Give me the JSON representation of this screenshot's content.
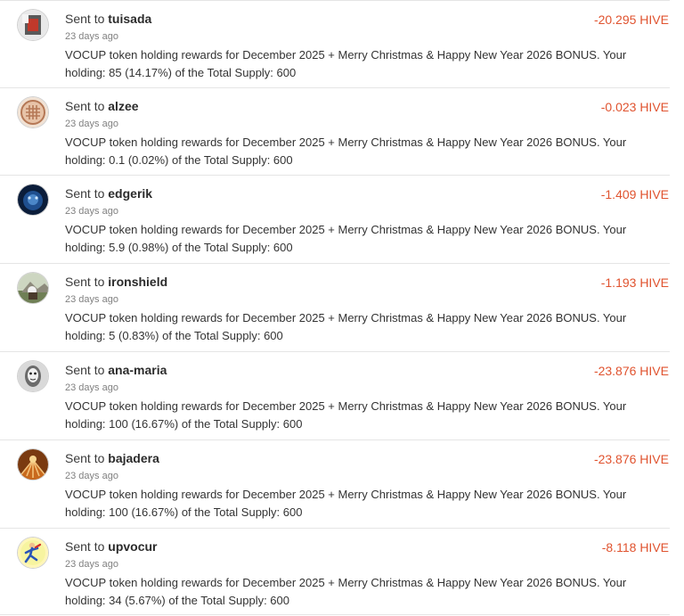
{
  "accent_amount_color": "#e0532f",
  "transfers": [
    {
      "prefix": "Sent to",
      "user": "tuisada",
      "time": "23 days ago",
      "memo": "VOCUP token holding rewards for December 2025 + Merry Christmas & Happy New Year 2026 BONUS. Your holding: 85 (14.17%) of the Total Supply: 600",
      "amount": "-20.295 HIVE",
      "avatar_icon": "phone-photo-avatar"
    },
    {
      "prefix": "Sent to",
      "user": "alzee",
      "time": "23 days ago",
      "memo": "VOCUP token holding rewards for December 2025 + Merry Christmas & Happy New Year 2026 BONUS. Your holding: 0.1 (0.02%) of the Total Supply: 600",
      "amount": "-0.023 HIVE",
      "avatar_icon": "crosshatch-logo-avatar"
    },
    {
      "prefix": "Sent to",
      "user": "edgerik",
      "time": "23 days ago",
      "memo": "VOCUP token holding rewards for December 2025 + Merry Christmas & Happy New Year 2026 BONUS. Your holding: 5.9 (0.98%) of the Total Supply: 600",
      "amount": "-1.409 HIVE",
      "avatar_icon": "blue-creature-avatar"
    },
    {
      "prefix": "Sent to",
      "user": "ironshield",
      "time": "23 days ago",
      "memo": "VOCUP token holding rewards for December 2025 + Merry Christmas & Happy New Year 2026 BONUS. Your holding: 5 (0.83%) of the Total Supply: 600",
      "amount": "-1.193 HIVE",
      "avatar_icon": "landscape-photo-avatar"
    },
    {
      "prefix": "Sent to",
      "user": "ana-maria",
      "time": "23 days ago",
      "memo": "VOCUP token holding rewards for December 2025 + Merry Christmas & Happy New Year 2026 BONUS. Your holding: 100 (16.67%) of the Total Supply: 600",
      "amount": "-23.876 HIVE",
      "avatar_icon": "face-sketch-avatar"
    },
    {
      "prefix": "Sent to",
      "user": "bajadera",
      "time": "23 days ago",
      "memo": "VOCUP token holding rewards for December 2025 + Merry Christmas & Happy New Year 2026 BONUS. Your holding: 100 (16.67%) of the Total Supply: 600",
      "amount": "-23.876 HIVE",
      "avatar_icon": "sunburst-logo-avatar"
    },
    {
      "prefix": "Sent to",
      "user": "upvocur",
      "time": "23 days ago",
      "memo": "VOCUP token holding rewards for December 2025 + Merry Christmas & Happy New Year 2026 BONUS. Your holding: 34 (5.67%) of the Total Supply: 600",
      "amount": "-8.118 HIVE",
      "avatar_icon": "cartoon-runner-avatar"
    }
  ]
}
